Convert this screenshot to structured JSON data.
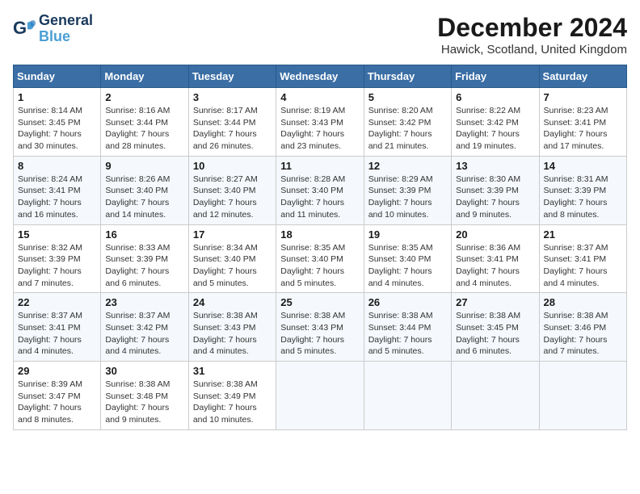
{
  "header": {
    "logo_line1": "General",
    "logo_line2": "Blue",
    "month_title": "December 2024",
    "location": "Hawick, Scotland, United Kingdom"
  },
  "days_of_week": [
    "Sunday",
    "Monday",
    "Tuesday",
    "Wednesday",
    "Thursday",
    "Friday",
    "Saturday"
  ],
  "weeks": [
    [
      {
        "num": "1",
        "info": "Sunrise: 8:14 AM\nSunset: 3:45 PM\nDaylight: 7 hours\nand 30 minutes."
      },
      {
        "num": "2",
        "info": "Sunrise: 8:16 AM\nSunset: 3:44 PM\nDaylight: 7 hours\nand 28 minutes."
      },
      {
        "num": "3",
        "info": "Sunrise: 8:17 AM\nSunset: 3:44 PM\nDaylight: 7 hours\nand 26 minutes."
      },
      {
        "num": "4",
        "info": "Sunrise: 8:19 AM\nSunset: 3:43 PM\nDaylight: 7 hours\nand 23 minutes."
      },
      {
        "num": "5",
        "info": "Sunrise: 8:20 AM\nSunset: 3:42 PM\nDaylight: 7 hours\nand 21 minutes."
      },
      {
        "num": "6",
        "info": "Sunrise: 8:22 AM\nSunset: 3:42 PM\nDaylight: 7 hours\nand 19 minutes."
      },
      {
        "num": "7",
        "info": "Sunrise: 8:23 AM\nSunset: 3:41 PM\nDaylight: 7 hours\nand 17 minutes."
      }
    ],
    [
      {
        "num": "8",
        "info": "Sunrise: 8:24 AM\nSunset: 3:41 PM\nDaylight: 7 hours\nand 16 minutes."
      },
      {
        "num": "9",
        "info": "Sunrise: 8:26 AM\nSunset: 3:40 PM\nDaylight: 7 hours\nand 14 minutes."
      },
      {
        "num": "10",
        "info": "Sunrise: 8:27 AM\nSunset: 3:40 PM\nDaylight: 7 hours\nand 12 minutes."
      },
      {
        "num": "11",
        "info": "Sunrise: 8:28 AM\nSunset: 3:40 PM\nDaylight: 7 hours\nand 11 minutes."
      },
      {
        "num": "12",
        "info": "Sunrise: 8:29 AM\nSunset: 3:39 PM\nDaylight: 7 hours\nand 10 minutes."
      },
      {
        "num": "13",
        "info": "Sunrise: 8:30 AM\nSunset: 3:39 PM\nDaylight: 7 hours\nand 9 minutes."
      },
      {
        "num": "14",
        "info": "Sunrise: 8:31 AM\nSunset: 3:39 PM\nDaylight: 7 hours\nand 8 minutes."
      }
    ],
    [
      {
        "num": "15",
        "info": "Sunrise: 8:32 AM\nSunset: 3:39 PM\nDaylight: 7 hours\nand 7 minutes."
      },
      {
        "num": "16",
        "info": "Sunrise: 8:33 AM\nSunset: 3:39 PM\nDaylight: 7 hours\nand 6 minutes."
      },
      {
        "num": "17",
        "info": "Sunrise: 8:34 AM\nSunset: 3:40 PM\nDaylight: 7 hours\nand 5 minutes."
      },
      {
        "num": "18",
        "info": "Sunrise: 8:35 AM\nSunset: 3:40 PM\nDaylight: 7 hours\nand 5 minutes."
      },
      {
        "num": "19",
        "info": "Sunrise: 8:35 AM\nSunset: 3:40 PM\nDaylight: 7 hours\nand 4 minutes."
      },
      {
        "num": "20",
        "info": "Sunrise: 8:36 AM\nSunset: 3:41 PM\nDaylight: 7 hours\nand 4 minutes."
      },
      {
        "num": "21",
        "info": "Sunrise: 8:37 AM\nSunset: 3:41 PM\nDaylight: 7 hours\nand 4 minutes."
      }
    ],
    [
      {
        "num": "22",
        "info": "Sunrise: 8:37 AM\nSunset: 3:41 PM\nDaylight: 7 hours\nand 4 minutes."
      },
      {
        "num": "23",
        "info": "Sunrise: 8:37 AM\nSunset: 3:42 PM\nDaylight: 7 hours\nand 4 minutes."
      },
      {
        "num": "24",
        "info": "Sunrise: 8:38 AM\nSunset: 3:43 PM\nDaylight: 7 hours\nand 4 minutes."
      },
      {
        "num": "25",
        "info": "Sunrise: 8:38 AM\nSunset: 3:43 PM\nDaylight: 7 hours\nand 5 minutes."
      },
      {
        "num": "26",
        "info": "Sunrise: 8:38 AM\nSunset: 3:44 PM\nDaylight: 7 hours\nand 5 minutes."
      },
      {
        "num": "27",
        "info": "Sunrise: 8:38 AM\nSunset: 3:45 PM\nDaylight: 7 hours\nand 6 minutes."
      },
      {
        "num": "28",
        "info": "Sunrise: 8:38 AM\nSunset: 3:46 PM\nDaylight: 7 hours\nand 7 minutes."
      }
    ],
    [
      {
        "num": "29",
        "info": "Sunrise: 8:39 AM\nSunset: 3:47 PM\nDaylight: 7 hours\nand 8 minutes."
      },
      {
        "num": "30",
        "info": "Sunrise: 8:38 AM\nSunset: 3:48 PM\nDaylight: 7 hours\nand 9 minutes."
      },
      {
        "num": "31",
        "info": "Sunrise: 8:38 AM\nSunset: 3:49 PM\nDaylight: 7 hours\nand 10 minutes."
      },
      null,
      null,
      null,
      null
    ]
  ]
}
